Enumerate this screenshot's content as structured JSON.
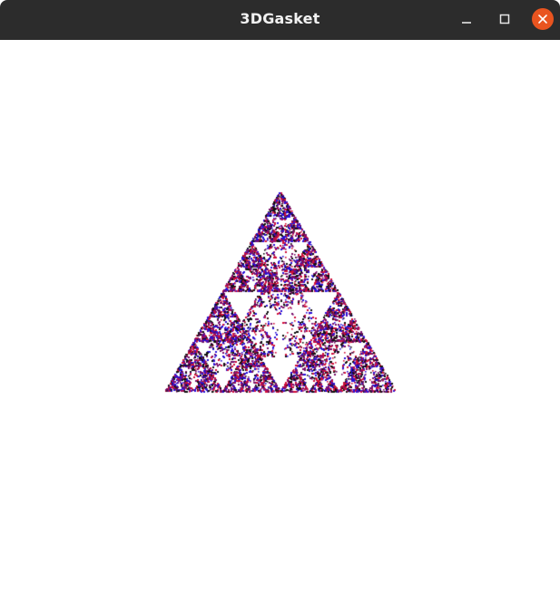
{
  "window": {
    "title": "3DGasket"
  },
  "titlebar": {
    "minimize_icon": "minimize-icon",
    "maximize_icon": "maximize-icon",
    "close_icon": "close-icon",
    "close_color": "#e9541f",
    "bar_color": "#2c2c2c"
  },
  "scene": {
    "type": "sierpinski-gasket-3d",
    "background": "#ffffff",
    "colors": [
      "#d10f3b",
      "#2a10d8",
      "#7a0e6a",
      "#111111"
    ]
  }
}
